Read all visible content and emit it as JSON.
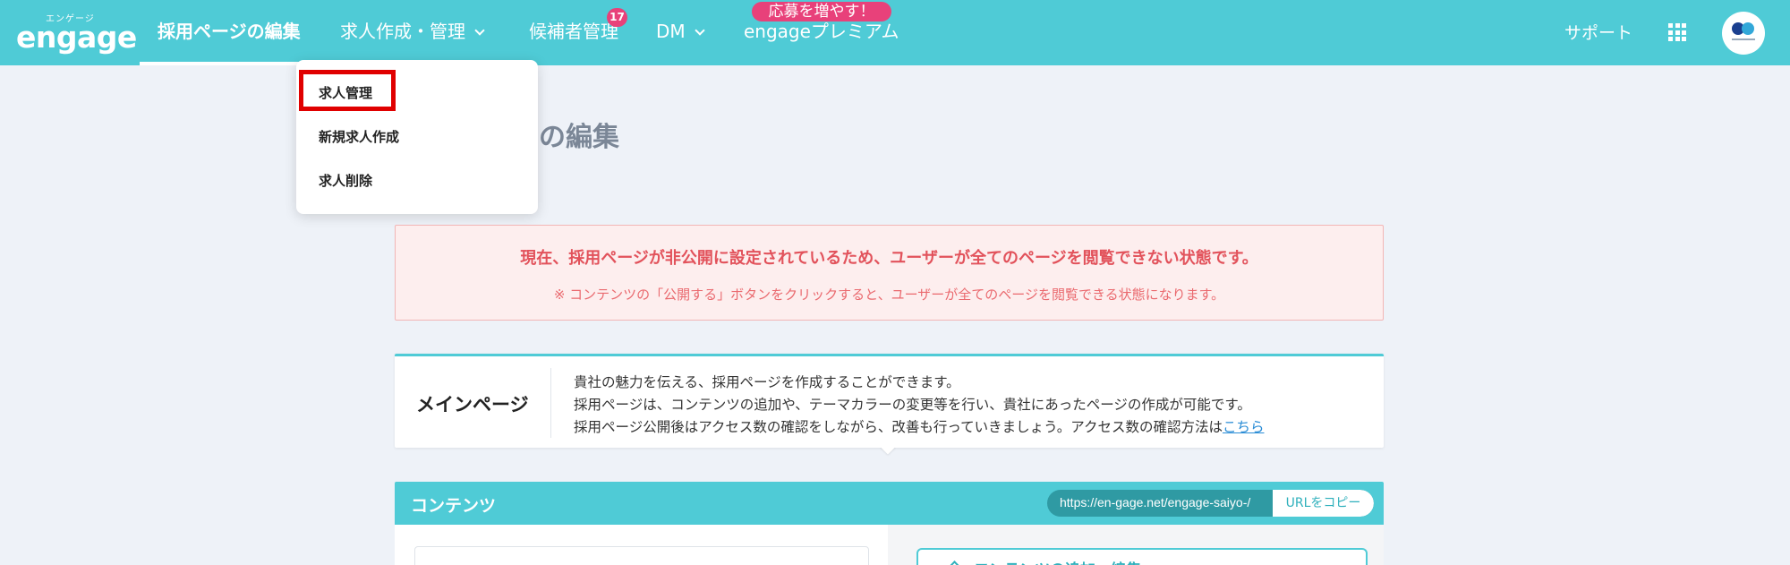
{
  "header": {
    "logo_kana": "エンゲージ",
    "logo_word": "engage",
    "nav": {
      "edit_page": "採用ページの編集",
      "jobs": "求人作成・管理",
      "candidates": "候補者管理",
      "candidates_count": "17",
      "dm": "DM",
      "premium": "engageプレミアム",
      "premium_badge": "応募を増やす！"
    },
    "support": "サポート",
    "accent_color": "#4fcbd6",
    "badge_color": "#e8417a"
  },
  "dropdown": {
    "items": [
      "求人管理",
      "新規求人作成",
      "求人削除"
    ],
    "highlight_color": "#e00000"
  },
  "page": {
    "title_visible": "の編集"
  },
  "alert": {
    "main": "現在、採用ページが非公開に設定されているため、ユーザーが全てのページを閲覧できない状態です。",
    "sub": "※ コンテンツの「公開する」ボタンをクリックすると、ユーザーが全てのページを閲覧できる状態になります。",
    "color": "#e2525b"
  },
  "main_card": {
    "title": "メインページ",
    "line1": "貴社の魅力を伝える、採用ページを作成することができます。",
    "line2": "採用ページは、コンテンツの追加や、テーマカラーの変更等を行い、貴社にあったページの作成が可能です。",
    "line3": "採用ページ公開後はアクセス数の確認をしながら、改善も行っていきましょう。アクセス数の確認方法は",
    "link": "こちら"
  },
  "contents": {
    "title": "コンテンツ",
    "url": "https://en-gage.net/engage-saiyo-/",
    "copy_button": "URLをコピー",
    "add_edit_label": "コンテンツの追加・編集"
  }
}
